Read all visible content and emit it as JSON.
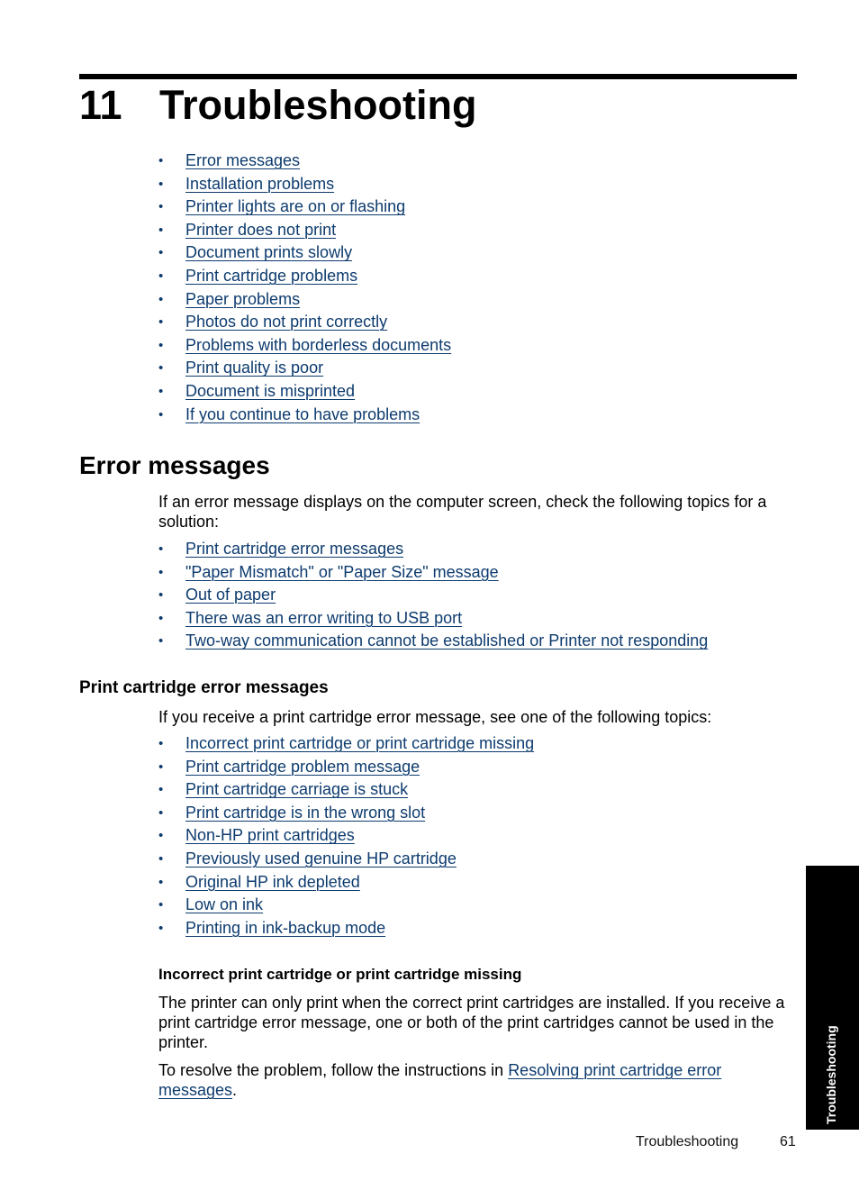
{
  "chapter": {
    "number": "11",
    "title": "Troubleshooting"
  },
  "toc_links": [
    "Error messages",
    "Installation problems",
    "Printer lights are on or flashing",
    "Printer does not print",
    "Document prints slowly",
    "Print cartridge problems",
    "Paper problems",
    "Photos do not print correctly",
    "Problems with borderless documents",
    "Print quality is poor",
    "Document is misprinted",
    "If you continue to have problems"
  ],
  "error_messages": {
    "heading": "Error messages",
    "intro": "If an error message displays on the computer screen, check the following topics for a solution:",
    "links": [
      "Print cartridge error messages",
      "\"Paper Mismatch\" or \"Paper Size\" message",
      "Out of paper",
      "There was an error writing to USB port",
      "Two-way communication cannot be established or Printer not responding"
    ]
  },
  "cartridge_errors": {
    "heading": "Print cartridge error messages",
    "intro": "If you receive a print cartridge error message, see one of the following topics:",
    "links": [
      "Incorrect print cartridge or print cartridge missing",
      "Print cartridge problem message",
      "Print cartridge carriage is stuck",
      "Print cartridge is in the wrong slot",
      "Non-HP print cartridges",
      "Previously used genuine HP cartridge",
      "Original HP ink depleted",
      "Low on ink",
      "Printing in ink-backup mode"
    ]
  },
  "incorrect_cartridge": {
    "heading": "Incorrect print cartridge or print cartridge missing",
    "body": "The printer can only print when the correct print cartridges are installed. If you receive a print cartridge error message, one or both of the print cartridges cannot be used in the printer.",
    "resolve_prefix": "To resolve the problem, follow the instructions in ",
    "resolve_link": "Resolving print cartridge error messages",
    "resolve_suffix": "."
  },
  "side_tab": {
    "label": "Troubleshooting"
  },
  "footer": {
    "section": "Troubleshooting",
    "page_number": "61"
  },
  "colors": {
    "link": "#0d3b6e",
    "text": "#000000",
    "tab_background": "#000000"
  }
}
